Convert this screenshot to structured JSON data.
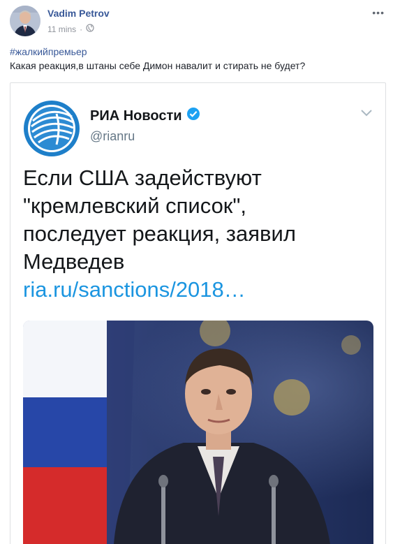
{
  "post": {
    "author": "Vadim Petrov",
    "time": "11 mins",
    "separator": "·",
    "more_label": "•••",
    "hashtag": "#жалкийпремьер",
    "text": "Какая реакция,в штаны себе Димон навалит и стирать не будет?"
  },
  "tweet": {
    "account_name": "РИА Новости",
    "handle": "@rianru",
    "lines": [
      "Если США задействуют",
      "\"кремлевский список\",",
      "последует реакция, заявил",
      "Медведев"
    ],
    "link": "ria.ru/sanctions/2018…"
  },
  "icons": {
    "privacy": "globe-icon",
    "verified": "verified-badge-icon",
    "menu": "chevron-down-icon"
  },
  "colors": {
    "author": "#385898",
    "link": "#1b95e0",
    "verified": "#1da1f2"
  }
}
